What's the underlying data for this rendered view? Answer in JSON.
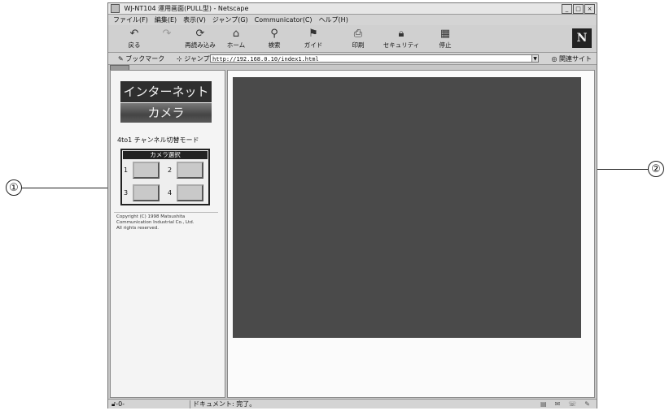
{
  "callouts": [
    "①",
    "②"
  ],
  "window": {
    "title": "WJ-NT104 運用画面(PULL型) - Netscape",
    "controls": [
      "_",
      "□",
      "×"
    ]
  },
  "menu": [
    "ファイル(F)",
    "編集(E)",
    "表示(V)",
    "ジャンプ(G)",
    "Communicator(C)",
    "ヘルプ(H)"
  ],
  "toolbar": {
    "buttons": [
      {
        "label": "戻る",
        "icon": "back-icon"
      },
      {
        "label": "",
        "icon": "forward-icon"
      },
      {
        "label": "再読み込み",
        "icon": "reload-icon"
      },
      {
        "label": "ホーム",
        "icon": "home-icon"
      },
      {
        "label": "検索",
        "icon": "search-icon"
      },
      {
        "label": "ガイド",
        "icon": "guide-icon"
      },
      {
        "label": "印刷",
        "icon": "print-icon"
      },
      {
        "label": "セキュリティ",
        "icon": "security-icon"
      },
      {
        "label": "停止",
        "icon": "stop-icon"
      }
    ],
    "brand": "N"
  },
  "location": {
    "bookmarks": "ブックマーク",
    "jump": "ジャンプ先",
    "url": "http://192.168.0.10/index1.html",
    "related": "関連サイト"
  },
  "left": {
    "logo_line1": "インターネット",
    "logo_line2": "カメラ",
    "mode": "4to1 チャンネル切替モード",
    "camera_select": {
      "title": "カメラ選択",
      "cameras": [
        "1",
        "2",
        "3",
        "4"
      ]
    },
    "copyright": "Copyright (C) 1998 Matsushita\nCommunication Industrial Co., Ltd.\nAll rights reserved."
  },
  "status": {
    "security": "-0-",
    "message": "ドキュメント: 完了。"
  },
  "colors": {
    "video_bg": "#4a4a4a",
    "chrome": "#d4d4d4"
  }
}
